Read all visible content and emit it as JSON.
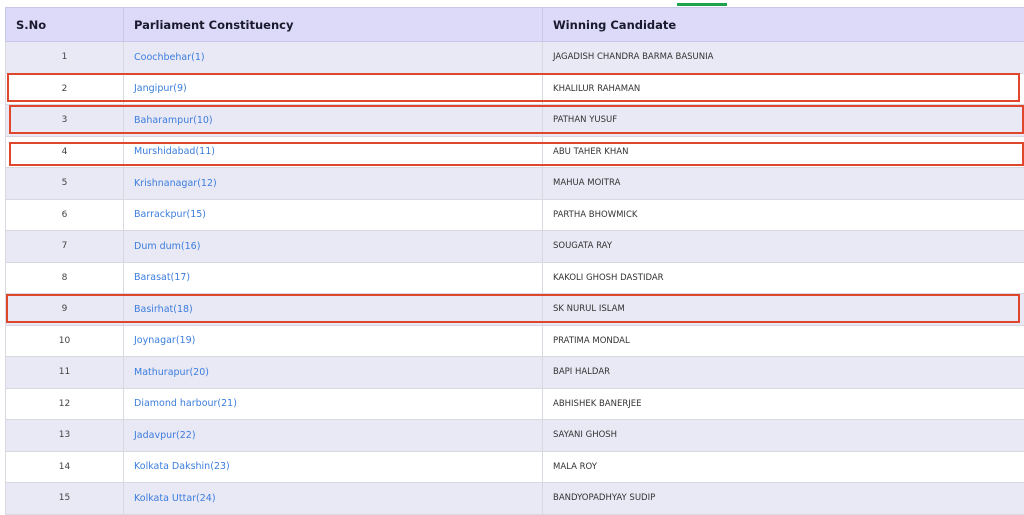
{
  "table": {
    "headers": [
      "S.No",
      "Parliament Constituency",
      "Winning Candidate"
    ],
    "rows": [
      {
        "sno": "1",
        "constituency": "Coochbehar(1)",
        "candidate": "JAGADISH CHANDRA BARMA BASUNIA"
      },
      {
        "sno": "2",
        "constituency": "Jangipur(9)",
        "candidate": "KHALILUR RAHAMAN"
      },
      {
        "sno": "3",
        "constituency": "Baharampur(10)",
        "candidate": "PATHAN YUSUF"
      },
      {
        "sno": "4",
        "constituency": "Murshidabad(11)",
        "candidate": "ABU TAHER KHAN"
      },
      {
        "sno": "5",
        "constituency": "Krishnanagar(12)",
        "candidate": "MAHUA MOITRA"
      },
      {
        "sno": "6",
        "constituency": "Barrackpur(15)",
        "candidate": "PARTHA BHOWMICK"
      },
      {
        "sno": "7",
        "constituency": "Dum dum(16)",
        "candidate": "SOUGATA RAY"
      },
      {
        "sno": "8",
        "constituency": "Barasat(17)",
        "candidate": "KAKOLI GHOSH DASTIDAR"
      },
      {
        "sno": "9",
        "constituency": "Basirhat(18)",
        "candidate": "SK NURUL ISLAM"
      },
      {
        "sno": "10",
        "constituency": "Joynagar(19)",
        "candidate": "PRATIMA MONDAL"
      },
      {
        "sno": "11",
        "constituency": "Mathurapur(20)",
        "candidate": "BAPI HALDAR"
      },
      {
        "sno": "12",
        "constituency": "Diamond harbour(21)",
        "candidate": "ABHISHEK BANERJEE"
      },
      {
        "sno": "13",
        "constituency": "Jadavpur(22)",
        "candidate": "SAYANI GHOSH"
      },
      {
        "sno": "14",
        "constituency": "Kolkata Dakshin(23)",
        "candidate": "MALA ROY"
      },
      {
        "sno": "15",
        "constituency": "Kolkata Uttar(24)",
        "candidate": "BANDYOPADHYAY SUDIP"
      }
    ]
  },
  "highlighted_rows": [
    "2",
    "3",
    "4",
    "9"
  ],
  "colors": {
    "header_bg": "#dcdaf8",
    "stripe_bg": "#e9e8f5",
    "link": "#3b7ddd",
    "highlight": "#e0462c",
    "accent": "#1fa34a"
  }
}
